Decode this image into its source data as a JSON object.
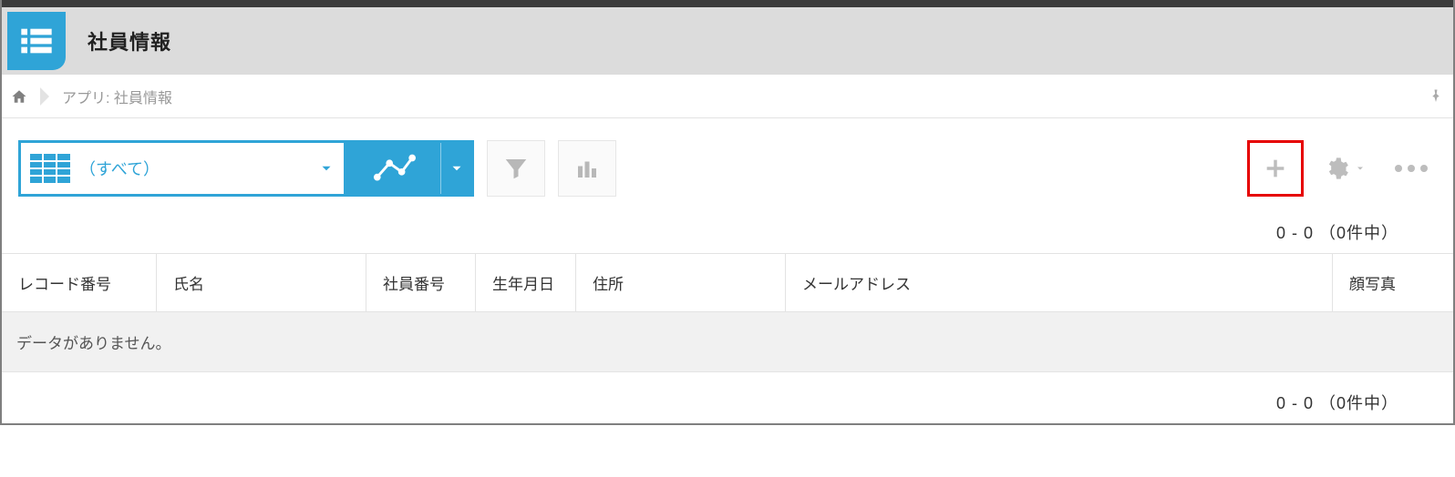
{
  "header": {
    "title": "社員情報"
  },
  "breadcrumb": {
    "text": "アプリ: 社員情報"
  },
  "toolbar": {
    "view_label": "（すべて）"
  },
  "pagination": {
    "top": "0 - 0 （0件中）",
    "bottom": "0 - 0 （0件中）"
  },
  "table": {
    "columns": [
      "レコード番号",
      "氏名",
      "社員番号",
      "生年月日",
      "住所",
      "メールアドレス",
      "顔写真"
    ],
    "empty_message": "データがありません。"
  }
}
